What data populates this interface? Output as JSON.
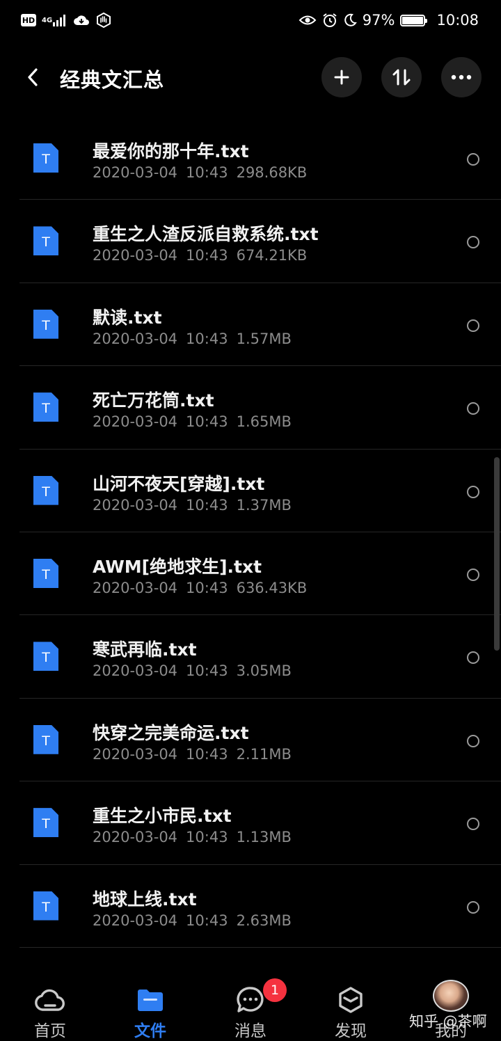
{
  "status_bar": {
    "hd_label": "HD",
    "network_label": "4G",
    "battery_text": "97%",
    "battery_level": 0.97,
    "time": "10:08"
  },
  "header": {
    "title": "经典文汇总",
    "icons": [
      "back-icon",
      "plus-icon",
      "sort-icon",
      "more-icon"
    ]
  },
  "file_list": {
    "icon_letter": "T",
    "items": [
      {
        "name": "最爱你的那十年.txt",
        "date": "2020-03-04",
        "time": "10:43",
        "size": "298.68KB"
      },
      {
        "name": "重生之人渣反派自救系统.txt",
        "date": "2020-03-04",
        "time": "10:43",
        "size": "674.21KB"
      },
      {
        "name": "默读.txt",
        "date": "2020-03-04",
        "time": "10:43",
        "size": "1.57MB"
      },
      {
        "name": "死亡万花筒.txt",
        "date": "2020-03-04",
        "time": "10:43",
        "size": "1.65MB"
      },
      {
        "name": "山河不夜天[穿越].txt",
        "date": "2020-03-04",
        "time": "10:43",
        "size": "1.37MB"
      },
      {
        "name": "AWM[绝地求生].txt",
        "date": "2020-03-04",
        "time": "10:43",
        "size": "636.43KB"
      },
      {
        "name": "寒武再临.txt",
        "date": "2020-03-04",
        "time": "10:43",
        "size": "3.05MB"
      },
      {
        "name": "快穿之完美命运.txt",
        "date": "2020-03-04",
        "time": "10:43",
        "size": "2.11MB"
      },
      {
        "name": "重生之小市民.txt",
        "date": "2020-03-04",
        "time": "10:43",
        "size": "1.13MB"
      },
      {
        "name": "地球上线.txt",
        "date": "2020-03-04",
        "time": "10:43",
        "size": "2.63MB"
      }
    ]
  },
  "bottom_nav": {
    "items": [
      {
        "label": "首页",
        "icon": "cloud-icon"
      },
      {
        "label": "文件",
        "icon": "folder-icon"
      },
      {
        "label": "消息",
        "icon": "chat-icon"
      },
      {
        "label": "发现",
        "icon": "cube-icon"
      },
      {
        "label": "我的",
        "icon": "avatar"
      }
    ],
    "message_badge": "1"
  },
  "watermark": "知乎 @茶啊",
  "colors": {
    "accent": "#2f7ef2",
    "badge": "#f5323f",
    "background": "#000000"
  }
}
